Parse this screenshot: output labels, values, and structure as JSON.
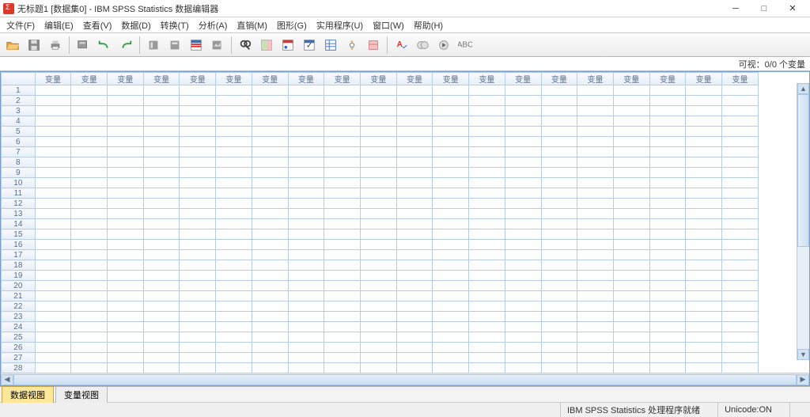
{
  "window": {
    "title": "无标题1 [数据集0] - IBM SPSS Statistics 数据编辑器"
  },
  "menu": {
    "file": "文件(F)",
    "edit": "编辑(E)",
    "view": "查看(V)",
    "data": "数据(D)",
    "transform": "转换(T)",
    "analyze": "分析(A)",
    "direct": "直销(M)",
    "graphs": "图形(G)",
    "utilities": "实用程序(U)",
    "window": "窗口(W)",
    "help": "帮助(H)"
  },
  "visible": {
    "label": "可视：0/0 个变量"
  },
  "grid": {
    "col_header": "变量",
    "num_cols": 20,
    "num_rows": 30
  },
  "tabs": {
    "data_view": "数据视图",
    "variable_view": "变量视图"
  },
  "status": {
    "processor": "IBM SPSS Statistics 处理程序就绪",
    "unicode": "Unicode:ON"
  }
}
